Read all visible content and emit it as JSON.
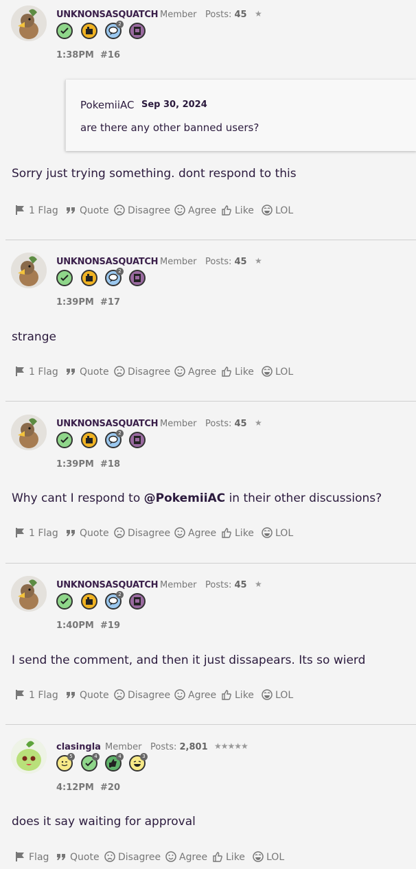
{
  "colors": {
    "accent": "#3a1f4a",
    "muted": "#777777",
    "background": "#f4f4f4"
  },
  "posts": [
    {
      "username": "UNKNONSASQUATCH",
      "role": "Member",
      "posts_label": "Posts:",
      "posts_count": "45",
      "stars": "★",
      "time": "1:38PM",
      "number": "#16",
      "badges": [
        {
          "name": "check-badge",
          "count": ""
        },
        {
          "name": "shop-badge",
          "count": ""
        },
        {
          "name": "comment-badge",
          "count": "2"
        },
        {
          "name": "notebook-badge",
          "count": ""
        }
      ],
      "quote": {
        "author": "PokemiiAC",
        "date": "Sep 30, 2024",
        "text": "are there any other banned users?"
      },
      "body_pre": "Sorry just trying something. dont respond to this",
      "mention": "",
      "body_post": "",
      "actions": {
        "flag": "1 Flag",
        "quote": "Quote",
        "disagree": "Disagree",
        "agree": "Agree",
        "like": "Like",
        "lol": "LOL"
      }
    },
    {
      "username": "UNKNONSASQUATCH",
      "role": "Member",
      "posts_label": "Posts:",
      "posts_count": "45",
      "stars": "★",
      "time": "1:39PM",
      "number": "#17",
      "badges": [
        {
          "name": "check-badge",
          "count": ""
        },
        {
          "name": "shop-badge",
          "count": ""
        },
        {
          "name": "comment-badge",
          "count": "2"
        },
        {
          "name": "notebook-badge",
          "count": ""
        }
      ],
      "body_pre": "strange",
      "mention": "",
      "body_post": "",
      "actions": {
        "flag": "1 Flag",
        "quote": "Quote",
        "disagree": "Disagree",
        "agree": "Agree",
        "like": "Like",
        "lol": "LOL"
      }
    },
    {
      "username": "UNKNONSASQUATCH",
      "role": "Member",
      "posts_label": "Posts:",
      "posts_count": "45",
      "stars": "★",
      "time": "1:39PM",
      "number": "#18",
      "badges": [
        {
          "name": "check-badge",
          "count": ""
        },
        {
          "name": "shop-badge",
          "count": ""
        },
        {
          "name": "comment-badge",
          "count": "2"
        },
        {
          "name": "notebook-badge",
          "count": ""
        }
      ],
      "body_pre": "Why cant I respond to ",
      "mention": "@PokemiiAC",
      "body_post": " in their other discussions?",
      "actions": {
        "flag": "1 Flag",
        "quote": "Quote",
        "disagree": "Disagree",
        "agree": "Agree",
        "like": "Like",
        "lol": "LOL"
      }
    },
    {
      "username": "UNKNONSASQUATCH",
      "role": "Member",
      "posts_label": "Posts:",
      "posts_count": "45",
      "stars": "★",
      "time": "1:40PM",
      "number": "#19",
      "badges": [
        {
          "name": "check-badge",
          "count": ""
        },
        {
          "name": "shop-badge",
          "count": ""
        },
        {
          "name": "comment-badge",
          "count": "2"
        },
        {
          "name": "notebook-badge",
          "count": ""
        }
      ],
      "body_pre": "I send the comment, and then it just dissapears. Its so wierd",
      "mention": "",
      "body_post": "",
      "actions": {
        "flag": "1 Flag",
        "quote": "Quote",
        "disagree": "Disagree",
        "agree": "Agree",
        "like": "Like",
        "lol": "LOL"
      }
    },
    {
      "username": "clasingla",
      "role": "Member",
      "posts_label": "Posts:",
      "posts_count": "2,801",
      "stars": "★★★★★",
      "time": "4:12PM",
      "number": "#20",
      "badges": [
        {
          "name": "wink-badge",
          "count": "5"
        },
        {
          "name": "check-badge",
          "count": "4"
        },
        {
          "name": "thumbs-badge",
          "count": "4"
        },
        {
          "name": "grin-badge",
          "count": "3"
        }
      ],
      "body_pre": "does it say waiting for approval",
      "mention": "",
      "body_post": "",
      "actions": {
        "flag": "Flag",
        "quote": "Quote",
        "disagree": "Disagree",
        "agree": "Agree",
        "like": "Like",
        "lol": "LOL"
      }
    }
  ]
}
